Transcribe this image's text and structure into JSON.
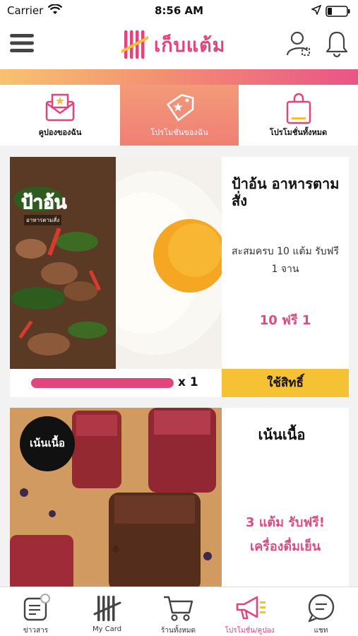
{
  "status_bar": {
    "carrier": "Carrier",
    "time": "8:56 AM"
  },
  "header": {
    "app_name": "เก็บแต้ม"
  },
  "tabs": [
    {
      "label": "คูปองของฉัน",
      "active": false,
      "icon": "coupon-envelope-icon"
    },
    {
      "label": "โปรโมชั่นของฉัน",
      "active": true,
      "icon": "tag-star-icon"
    },
    {
      "label": "โปรโมชั่นทั้งหมด",
      "active": false,
      "icon": "shopping-bag-icon"
    }
  ],
  "cards": [
    {
      "shop_name": "ป้าอ้น อาหารตามสั่ง",
      "promo_desc": "สะสมครบ 10 แต้ม รับฟรี 1 จาน",
      "promo_short": "10 ฟรี 1",
      "progress": 1.0,
      "count": "x 1",
      "redeem_label": "ใช้สิทธิ์",
      "logo_text": "ป้าอ้น",
      "logo_sub": "อาหารตามสั่ง"
    },
    {
      "shop_name": "เน้นเนื้อ",
      "promo_line1": "3 แต้ม รับฟรี!",
      "promo_line2": "เครื่องดื่มเย็น",
      "logo_text": "เน้นเนื้อ"
    }
  ],
  "bottom_nav": [
    {
      "label": "ข่าวสาร",
      "icon": "news-icon",
      "active": false
    },
    {
      "label": "My Card",
      "icon": "tally-card-icon",
      "active": false
    },
    {
      "label": "ร้านทั้งหมด",
      "icon": "shopping-cart-icon",
      "active": false
    },
    {
      "label": "โปรโมชั่น/คูปอง",
      "icon": "megaphone-icon",
      "active": true
    },
    {
      "label": "แชท",
      "icon": "chat-icon",
      "active": false
    }
  ],
  "colors": {
    "brand": "#e0457b",
    "accent_yellow": "#f4c233",
    "tab_active": "#f07f75"
  }
}
